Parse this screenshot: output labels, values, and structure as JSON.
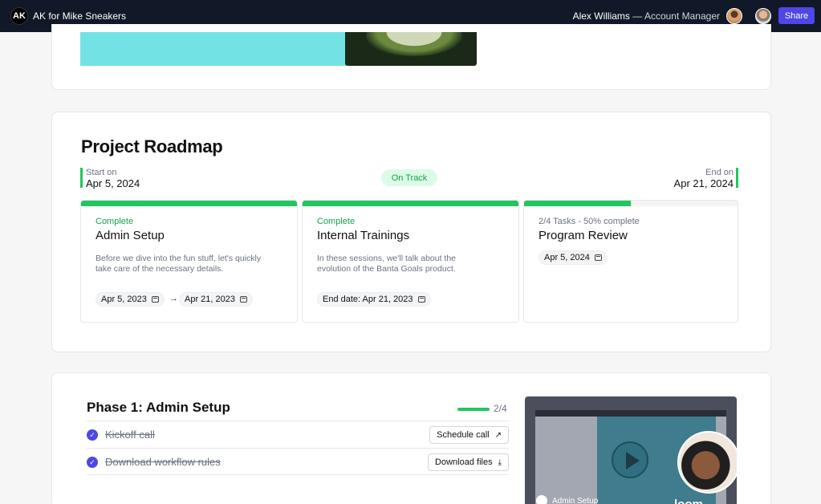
{
  "header": {
    "logo_text": "AK",
    "app_title": "AK for Mike Sneakers",
    "user_name": "Alex Williams",
    "user_role": "— Account Manager",
    "share_label": "Share",
    "accent": "#4f46e5",
    "bg": "#111827"
  },
  "roadmap": {
    "title": "Project Roadmap",
    "start_label": "Start on",
    "start_date": "Apr 5, 2024",
    "end_label": "End on",
    "end_date": "Apr 21, 2024",
    "status": "On Track",
    "phases": [
      {
        "status": "Complete",
        "title": "Admin Setup",
        "progress": 1.0,
        "description": "Before we dive into the fun stuff, let's quickly take care of the necessary details.",
        "date_start": "Apr 5, 2023",
        "date_end": "Apr 21, 2023"
      },
      {
        "status": "Complete",
        "title": "Internal Trainings",
        "progress": 1.0,
        "description": "In these sessions, we'll talk about the evolution of the Banta Goals product.",
        "end_date": "End date: Apr 21, 2023"
      },
      {
        "status": "2/4 Tasks - 50% complete",
        "title": "Program Review",
        "progress": 0.5,
        "date": "Apr 5, 2024"
      }
    ]
  },
  "phase1": {
    "title": "Phase 1: Admin Setup",
    "count": "2/4",
    "tasks": [
      {
        "label": "Kickoff call",
        "done": true,
        "action": "Schedule call",
        "action_icon": "external-link-icon"
      },
      {
        "label": "Download workflow rules",
        "done": true,
        "action": "Download files",
        "action_icon": "download-icon"
      }
    ],
    "video": {
      "caption": "Admin Setup",
      "brand": "loom"
    }
  },
  "colors": {
    "success": "#22c55e",
    "success_text": "#16a34a",
    "hero_teal": "#73e2e5"
  }
}
